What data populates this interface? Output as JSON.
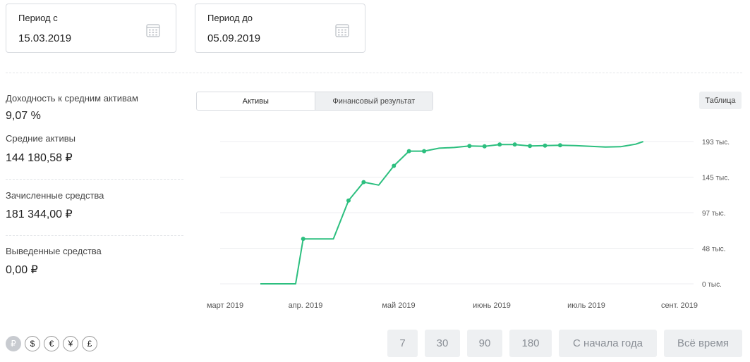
{
  "period_from": {
    "label": "Период с",
    "value": "15.03.2019"
  },
  "period_to": {
    "label": "Период до",
    "value": "05.09.2019"
  },
  "metrics": [
    {
      "label": "Доходность к средним активам",
      "value": "9,07 %"
    },
    {
      "label": "Средние активы",
      "value": "144 180,58 ₽"
    },
    {
      "label": "Зачисленные средства",
      "value": "181 344,00 ₽"
    },
    {
      "label": "Выведенные средства",
      "value": "0,00 ₽"
    }
  ],
  "tabs": [
    {
      "label": "Активы",
      "active": true
    },
    {
      "label": "Финансовый результат",
      "active": false
    }
  ],
  "table_button": "Таблица",
  "currencies": [
    {
      "symbol": "₽",
      "active": true
    },
    {
      "symbol": "$",
      "active": false
    },
    {
      "symbol": "€",
      "active": false
    },
    {
      "symbol": "¥",
      "active": false
    },
    {
      "symbol": "£",
      "active": false
    }
  ],
  "ranges": [
    "7",
    "30",
    "90",
    "180",
    "С начала года",
    "Всё время"
  ],
  "colors": {
    "line": "#2cbf7f",
    "grid": "#eceef0",
    "button_bg": "#eef0f2"
  },
  "chart_data": {
    "type": "line",
    "x_tick_labels": [
      "март 2019",
      "апр. 2019",
      "май 2019",
      "июнь 2019",
      "июль 2019",
      "сент. 2019"
    ],
    "y_tick_labels": [
      "193 тыс.",
      "145 тыс.",
      "97 тыс.",
      "48 тыс.",
      "0 тыс."
    ],
    "ylim": [
      0,
      193000
    ],
    "series": [
      {
        "line_points": [
          [
            "2019-03-15",
            0
          ],
          [
            "2019-03-29",
            0
          ],
          [
            "2019-04-01",
            61000
          ],
          [
            "2019-04-13",
            61000
          ],
          [
            "2019-04-19",
            113000
          ],
          [
            "2019-04-25",
            138000
          ],
          [
            "2019-05-01",
            134000
          ],
          [
            "2019-05-07",
            160000
          ],
          [
            "2019-05-13",
            180000
          ],
          [
            "2019-05-19",
            180000
          ],
          [
            "2019-05-25",
            184000
          ],
          [
            "2019-05-31",
            185000
          ],
          [
            "2019-06-06",
            187000
          ],
          [
            "2019-06-12",
            186500
          ],
          [
            "2019-06-18",
            189000
          ],
          [
            "2019-06-24",
            189000
          ],
          [
            "2019-06-30",
            187000
          ],
          [
            "2019-07-06",
            187500
          ],
          [
            "2019-07-12",
            188000
          ],
          [
            "2019-07-18",
            187500
          ],
          [
            "2019-07-24",
            186500
          ],
          [
            "2019-07-30",
            185500
          ],
          [
            "2019-08-05",
            186000
          ],
          [
            "2019-08-11",
            189500
          ],
          [
            "2019-08-14",
            193000
          ]
        ],
        "marker_points": [
          [
            "2019-04-01",
            61000
          ],
          [
            "2019-04-19",
            113000
          ],
          [
            "2019-04-25",
            138000
          ],
          [
            "2019-05-07",
            160000
          ],
          [
            "2019-05-13",
            180000
          ],
          [
            "2019-05-19",
            180000
          ],
          [
            "2019-06-06",
            187000
          ],
          [
            "2019-06-12",
            186500
          ],
          [
            "2019-06-18",
            189000
          ],
          [
            "2019-06-24",
            189000
          ],
          [
            "2019-06-30",
            187000
          ],
          [
            "2019-07-06",
            187500
          ],
          [
            "2019-07-12",
            188000
          ]
        ]
      }
    ]
  }
}
